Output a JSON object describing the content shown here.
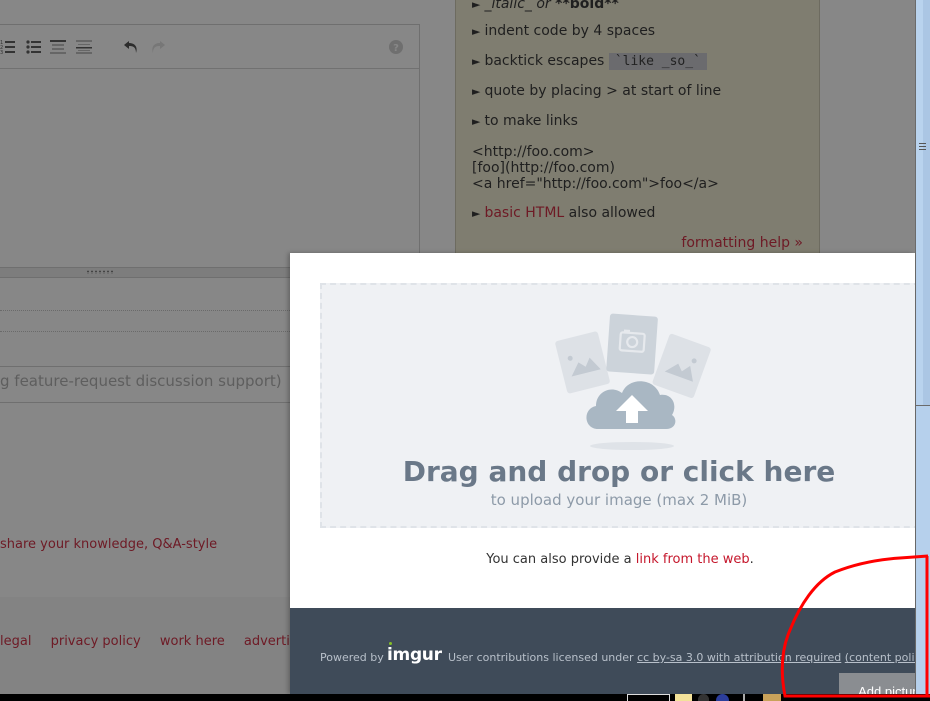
{
  "editor": {
    "toolbar": {
      "icons": [
        "numbered-list-icon",
        "bulleted-list-icon",
        "heading-icon",
        "horizontal-rule-icon",
        "undo-icon",
        "redo-icon",
        "help-icon"
      ]
    },
    "tags_placeholder_tail": "g feature-request discussion support)"
  },
  "page": {
    "share_link": "share your knowledge, Q&A-style",
    "footer_links": [
      "legal",
      "privacy policy",
      "work here",
      "advertising"
    ]
  },
  "help_panel": {
    "items": [
      {
        "prefix": "_italic_ or ",
        "bold": "**bold**"
      },
      {
        "text": "indent code by 4 spaces"
      },
      {
        "text": "backtick escapes ",
        "code": "`like _so_`"
      },
      {
        "text": "quote by placing > at start of line"
      },
      {
        "text": "to make links"
      }
    ],
    "code_lines": [
      "<http://foo.com>",
      "[foo](http://foo.com)",
      "<a href=\"http://foo.com\">foo</a>"
    ],
    "html_link": "basic HTML",
    "html_suffix": " also allowed",
    "formatting_help": "formatting help »",
    "bullet": "►"
  },
  "modal": {
    "drop_title": "Drag and drop or click here",
    "drop_subtitle": "to upload your image (max 2 MiB)",
    "web_prefix": "You can also provide a ",
    "web_link": "link from the web",
    "web_suffix": ".",
    "footer": {
      "powered_by": "Powered by",
      "brand": "imgur",
      "license_prefix": "User contributions licensed under ",
      "license_link": "cc by-sa 3.0 with attribution required",
      "content_policy": "(content policy)"
    },
    "add_picture": "Add picture"
  },
  "colors": {
    "overlay": "#878787",
    "link_red": "#c5172c",
    "modal_footer": "#3f4b59",
    "annotation": "#ff0000",
    "imgur_dot": "#85bf25"
  }
}
